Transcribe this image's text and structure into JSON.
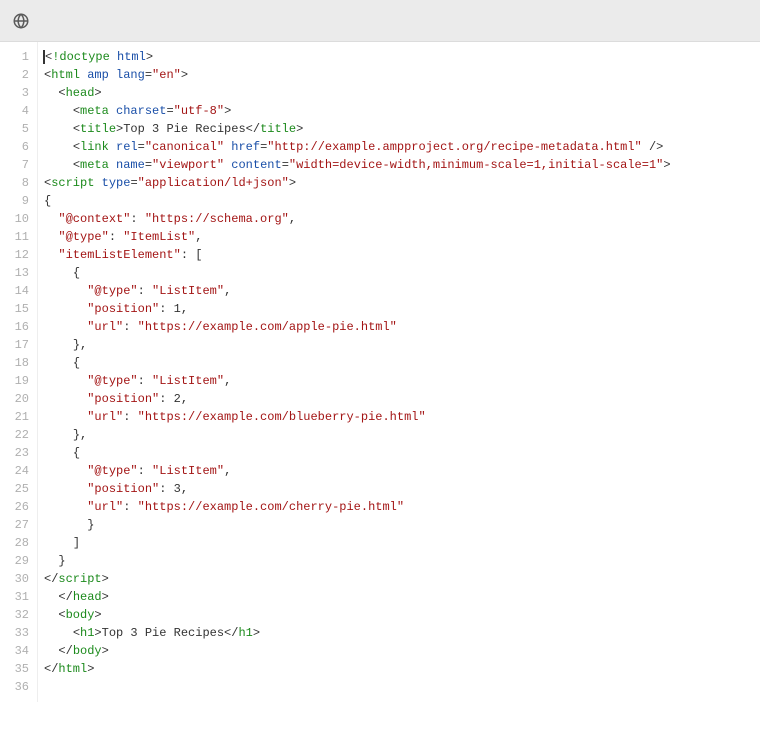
{
  "toolbar": {
    "globe_icon": "globe"
  },
  "code": {
    "lines": [
      [
        [
          0,
          "pun",
          "<"
        ],
        [
          0,
          "tag",
          "!doctype"
        ],
        [
          0,
          "txt",
          " "
        ],
        [
          0,
          "attr",
          "html"
        ],
        [
          0,
          "pun",
          ">"
        ]
      ],
      [
        [
          0,
          "pun",
          "<"
        ],
        [
          0,
          "tag",
          "html"
        ],
        [
          0,
          "txt",
          " "
        ],
        [
          0,
          "attr",
          "amp"
        ],
        [
          0,
          "txt",
          " "
        ],
        [
          0,
          "attr",
          "lang"
        ],
        [
          0,
          "pun",
          "="
        ],
        [
          0,
          "str",
          "\"en\""
        ],
        [
          0,
          "pun",
          ">"
        ]
      ],
      [
        [
          2,
          "pun",
          "<"
        ],
        [
          0,
          "tag",
          "head"
        ],
        [
          0,
          "pun",
          ">"
        ]
      ],
      [
        [
          4,
          "pun",
          "<"
        ],
        [
          0,
          "tag",
          "meta"
        ],
        [
          0,
          "txt",
          " "
        ],
        [
          0,
          "attr",
          "charset"
        ],
        [
          0,
          "pun",
          "="
        ],
        [
          0,
          "str",
          "\"utf-8\""
        ],
        [
          0,
          "pun",
          ">"
        ]
      ],
      [
        [
          4,
          "pun",
          "<"
        ],
        [
          0,
          "tag",
          "title"
        ],
        [
          0,
          "pun",
          ">"
        ],
        [
          0,
          "txt",
          "Top 3 Pie Recipes"
        ],
        [
          0,
          "pun",
          "</"
        ],
        [
          0,
          "tag",
          "title"
        ],
        [
          0,
          "pun",
          ">"
        ]
      ],
      [
        [
          4,
          "pun",
          "<"
        ],
        [
          0,
          "tag",
          "link"
        ],
        [
          0,
          "txt",
          " "
        ],
        [
          0,
          "attr",
          "rel"
        ],
        [
          0,
          "pun",
          "="
        ],
        [
          0,
          "str",
          "\"canonical\""
        ],
        [
          0,
          "txt",
          " "
        ],
        [
          0,
          "attr",
          "href"
        ],
        [
          0,
          "pun",
          "="
        ],
        [
          0,
          "str",
          "\"http://example.ampproject.org/recipe-metadata.html\""
        ],
        [
          0,
          "txt",
          " "
        ],
        [
          0,
          "pun",
          "/>"
        ]
      ],
      [
        [
          4,
          "pun",
          "<"
        ],
        [
          0,
          "tag",
          "meta"
        ],
        [
          0,
          "txt",
          " "
        ],
        [
          0,
          "attr",
          "name"
        ],
        [
          0,
          "pun",
          "="
        ],
        [
          0,
          "str",
          "\"viewport\""
        ],
        [
          0,
          "txt",
          " "
        ],
        [
          0,
          "attr",
          "content"
        ],
        [
          0,
          "pun",
          "="
        ],
        [
          0,
          "str",
          "\"width=device-width,minimum-scale=1,initial-scale=1\""
        ],
        [
          0,
          "pun",
          ">"
        ]
      ],
      [
        [
          0,
          "pun",
          "<"
        ],
        [
          0,
          "tag",
          "script"
        ],
        [
          0,
          "txt",
          " "
        ],
        [
          0,
          "attr",
          "type"
        ],
        [
          0,
          "pun",
          "="
        ],
        [
          0,
          "str",
          "\"application/ld+json\""
        ],
        [
          0,
          "pun",
          ">"
        ]
      ],
      [
        [
          0,
          "txt",
          "{"
        ]
      ],
      [
        [
          2,
          "str",
          "\"@context\""
        ],
        [
          0,
          "txt",
          ": "
        ],
        [
          0,
          "str",
          "\"https://schema.org\""
        ],
        [
          0,
          "txt",
          ","
        ]
      ],
      [
        [
          2,
          "str",
          "\"@type\""
        ],
        [
          0,
          "txt",
          ": "
        ],
        [
          0,
          "str",
          "\"ItemList\""
        ],
        [
          0,
          "txt",
          ","
        ]
      ],
      [
        [
          2,
          "str",
          "\"itemListElement\""
        ],
        [
          0,
          "txt",
          ": ["
        ]
      ],
      [
        [
          4,
          "txt",
          "{"
        ]
      ],
      [
        [
          6,
          "str",
          "\"@type\""
        ],
        [
          0,
          "txt",
          ": "
        ],
        [
          0,
          "str",
          "\"ListItem\""
        ],
        [
          0,
          "txt",
          ","
        ]
      ],
      [
        [
          6,
          "str",
          "\"position\""
        ],
        [
          0,
          "txt",
          ": 1,"
        ]
      ],
      [
        [
          6,
          "str",
          "\"url\""
        ],
        [
          0,
          "txt",
          ": "
        ],
        [
          0,
          "str",
          "\"https://example.com/apple-pie.html\""
        ]
      ],
      [
        [
          4,
          "txt",
          "},"
        ]
      ],
      [
        [
          4,
          "txt",
          "{"
        ]
      ],
      [
        [
          6,
          "str",
          "\"@type\""
        ],
        [
          0,
          "txt",
          ": "
        ],
        [
          0,
          "str",
          "\"ListItem\""
        ],
        [
          0,
          "txt",
          ","
        ]
      ],
      [
        [
          6,
          "str",
          "\"position\""
        ],
        [
          0,
          "txt",
          ": 2,"
        ]
      ],
      [
        [
          6,
          "str",
          "\"url\""
        ],
        [
          0,
          "txt",
          ": "
        ],
        [
          0,
          "str",
          "\"https://example.com/blueberry-pie.html\""
        ]
      ],
      [
        [
          4,
          "txt",
          "},"
        ]
      ],
      [
        [
          4,
          "txt",
          "{"
        ]
      ],
      [
        [
          6,
          "str",
          "\"@type\""
        ],
        [
          0,
          "txt",
          ": "
        ],
        [
          0,
          "str",
          "\"ListItem\""
        ],
        [
          0,
          "txt",
          ","
        ]
      ],
      [
        [
          6,
          "str",
          "\"position\""
        ],
        [
          0,
          "txt",
          ": 3,"
        ]
      ],
      [
        [
          6,
          "str",
          "\"url\""
        ],
        [
          0,
          "txt",
          ": "
        ],
        [
          0,
          "str",
          "\"https://example.com/cherry-pie.html\""
        ]
      ],
      [
        [
          6,
          "txt",
          "}"
        ]
      ],
      [
        [
          4,
          "txt",
          "]"
        ]
      ],
      [
        [
          2,
          "txt",
          "}"
        ]
      ],
      [
        [
          0,
          "pun",
          "</"
        ],
        [
          0,
          "tag",
          "script"
        ],
        [
          0,
          "pun",
          ">"
        ]
      ],
      [
        [
          2,
          "pun",
          "</"
        ],
        [
          0,
          "tag",
          "head"
        ],
        [
          0,
          "pun",
          ">"
        ]
      ],
      [
        [
          2,
          "pun",
          "<"
        ],
        [
          0,
          "tag",
          "body"
        ],
        [
          0,
          "pun",
          ">"
        ]
      ],
      [
        [
          4,
          "pun",
          "<"
        ],
        [
          0,
          "tag",
          "h1"
        ],
        [
          0,
          "pun",
          ">"
        ],
        [
          0,
          "txt",
          "Top 3 Pie Recipes"
        ],
        [
          0,
          "pun",
          "</"
        ],
        [
          0,
          "tag",
          "h1"
        ],
        [
          0,
          "pun",
          ">"
        ]
      ],
      [
        [
          2,
          "pun",
          "</"
        ],
        [
          0,
          "tag",
          "body"
        ],
        [
          0,
          "pun",
          ">"
        ]
      ],
      [
        [
          0,
          "pun",
          "</"
        ],
        [
          0,
          "tag",
          "html"
        ],
        [
          0,
          "pun",
          ">"
        ]
      ],
      []
    ],
    "cursor_line": 1
  }
}
